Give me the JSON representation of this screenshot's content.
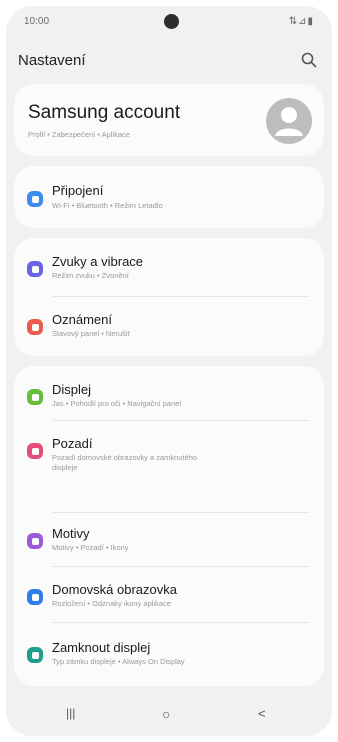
{
  "status": {
    "time": "10:00",
    "system_icons": "⇅⊿▮"
  },
  "header": {
    "title": "Nastavení"
  },
  "account": {
    "name": "Samsung account",
    "subtitle": "Profil • Zabezpečení • Aplikace"
  },
  "sections": [
    {
      "items": [
        {
          "label": "Připojení",
          "subtitle": "Wi-Fi • Bluetooth • Režim Letadlo",
          "color": "#3c8cf0",
          "icon": "wifi-icon"
        }
      ]
    },
    {
      "items": [
        {
          "label": "Zvuky a vibrace",
          "subtitle": "Režim zvuku • Zvonění",
          "color": "#6b63e5",
          "icon": "speaker-icon"
        },
        {
          "label": "Oznámení",
          "subtitle": "Stavový panel • Nerušit",
          "color": "#ec5b4e",
          "icon": "notification-icon"
        }
      ]
    },
    {
      "items": [
        {
          "label": "Displej",
          "subtitle": "Jas • Pohodlí pro oči • Navigační panel",
          "color": "#69bd3a",
          "icon": "sun-icon"
        },
        {
          "label": "Pozadí",
          "subtitle": "Pozadí domovské obrazovky a zamknutého displeje",
          "color": "#e54f7a",
          "icon": "wallpaper-icon"
        },
        {
          "label": "Motivy",
          "subtitle": "Motivy • Pozadí • Ikony",
          "color": "#9b5bd8",
          "icon": "brush-icon"
        },
        {
          "label": "Domovská obrazovka",
          "subtitle": "Rozložení • Odznaky ikony aplikace",
          "color": "#2f7ee8",
          "icon": "home-icon"
        },
        {
          "label": "Zamknout displej",
          "subtitle": "Typ zámku displeje • Always On Display",
          "color": "#1f9e8c",
          "icon": "lock-icon"
        }
      ]
    }
  ],
  "navbar": {
    "recent": "|||",
    "home": "○",
    "back": "<"
  }
}
